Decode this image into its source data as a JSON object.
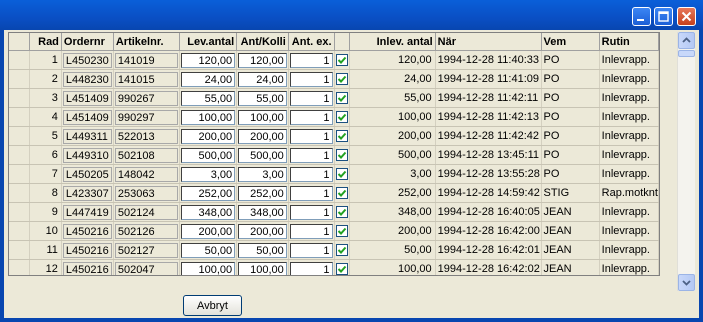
{
  "window": {
    "buttons": {
      "minimize": "minimize-icon",
      "maximize": "maximize-icon",
      "close": "close-icon"
    }
  },
  "table": {
    "headers": {
      "rad": "Rad",
      "ordernr": "Ordernr",
      "artikelnr": "Artikelnr.",
      "lev_antal": "Lev.antal",
      "ant_kolli": "Ant/Kolli",
      "ant_ex": "Ant. ex.",
      "check": "",
      "inlev_antal": "Inlev. antal",
      "nar": "När",
      "vem": "Vem",
      "rutin": "Rutin"
    },
    "rows": [
      {
        "rad": "1",
        "ordernr": "L450230",
        "artikelnr": "141019",
        "lev_antal": "120,00",
        "ant_kolli": "120,00",
        "ant_ex": "1",
        "checked": true,
        "inlev_antal": "120,00",
        "nar": "1994-12-28 11:40:33",
        "vem": "PO",
        "rutin": "Inlevrapp."
      },
      {
        "rad": "2",
        "ordernr": "L448230",
        "artikelnr": "141015",
        "lev_antal": "24,00",
        "ant_kolli": "24,00",
        "ant_ex": "1",
        "checked": true,
        "inlev_antal": "24,00",
        "nar": "1994-12-28 11:41:09",
        "vem": "PO",
        "rutin": "Inlevrapp."
      },
      {
        "rad": "3",
        "ordernr": "L451409",
        "artikelnr": "990267",
        "lev_antal": "55,00",
        "ant_kolli": "55,00",
        "ant_ex": "1",
        "checked": true,
        "inlev_antal": "55,00",
        "nar": "1994-12-28 11:42:11",
        "vem": "PO",
        "rutin": "Inlevrapp."
      },
      {
        "rad": "4",
        "ordernr": "L451409",
        "artikelnr": "990297",
        "lev_antal": "100,00",
        "ant_kolli": "100,00",
        "ant_ex": "1",
        "checked": true,
        "inlev_antal": "100,00",
        "nar": "1994-12-28 11:42:13",
        "vem": "PO",
        "rutin": "Inlevrapp."
      },
      {
        "rad": "5",
        "ordernr": "L449311",
        "artikelnr": "522013",
        "lev_antal": "200,00",
        "ant_kolli": "200,00",
        "ant_ex": "1",
        "checked": true,
        "inlev_antal": "200,00",
        "nar": "1994-12-28 11:42:42",
        "vem": "PO",
        "rutin": "Inlevrapp."
      },
      {
        "rad": "6",
        "ordernr": "L449310",
        "artikelnr": "502108",
        "lev_antal": "500,00",
        "ant_kolli": "500,00",
        "ant_ex": "1",
        "checked": true,
        "inlev_antal": "500,00",
        "nar": "1994-12-28 13:45:11",
        "vem": "PO",
        "rutin": "Inlevrapp."
      },
      {
        "rad": "7",
        "ordernr": "L450205",
        "artikelnr": "148042",
        "lev_antal": "3,00",
        "ant_kolli": "3,00",
        "ant_ex": "1",
        "checked": true,
        "inlev_antal": "3,00",
        "nar": "1994-12-28 13:55:28",
        "vem": "PO",
        "rutin": "Inlevrapp."
      },
      {
        "rad": "8",
        "ordernr": "L423307",
        "artikelnr": "253063",
        "lev_antal": "252,00",
        "ant_kolli": "252,00",
        "ant_ex": "1",
        "checked": true,
        "inlev_antal": "252,00",
        "nar": "1994-12-28 14:59:42",
        "vem": "STIG",
        "rutin": "Rap.motknt"
      },
      {
        "rad": "9",
        "ordernr": "L447419",
        "artikelnr": "502124",
        "lev_antal": "348,00",
        "ant_kolli": "348,00",
        "ant_ex": "1",
        "checked": true,
        "inlev_antal": "348,00",
        "nar": "1994-12-28 16:40:05",
        "vem": "JEAN",
        "rutin": "Inlevrapp."
      },
      {
        "rad": "10",
        "ordernr": "L450216",
        "artikelnr": "502126",
        "lev_antal": "200,00",
        "ant_kolli": "200,00",
        "ant_ex": "1",
        "checked": true,
        "inlev_antal": "200,00",
        "nar": "1994-12-28 16:42:00",
        "vem": "JEAN",
        "rutin": "Inlevrapp."
      },
      {
        "rad": "11",
        "ordernr": "L450216",
        "artikelnr": "502127",
        "lev_antal": "50,00",
        "ant_kolli": "50,00",
        "ant_ex": "1",
        "checked": true,
        "inlev_antal": "50,00",
        "nar": "1994-12-28 16:42:01",
        "vem": "JEAN",
        "rutin": "Inlevrapp."
      },
      {
        "rad": "12",
        "ordernr": "L450216",
        "artikelnr": "502047",
        "lev_antal": "100,00",
        "ant_kolli": "100,00",
        "ant_ex": "1",
        "checked": true,
        "inlev_antal": "100,00",
        "nar": "1994-12-28 16:42:02",
        "vem": "JEAN",
        "rutin": "Inlevrapp."
      }
    ]
  },
  "footer": {
    "cancel_label": "Avbryt"
  },
  "colors": {
    "titlebar": "#0a4fc4",
    "window_bg": "#ece9d8",
    "checkbox_check": "#21a121"
  }
}
